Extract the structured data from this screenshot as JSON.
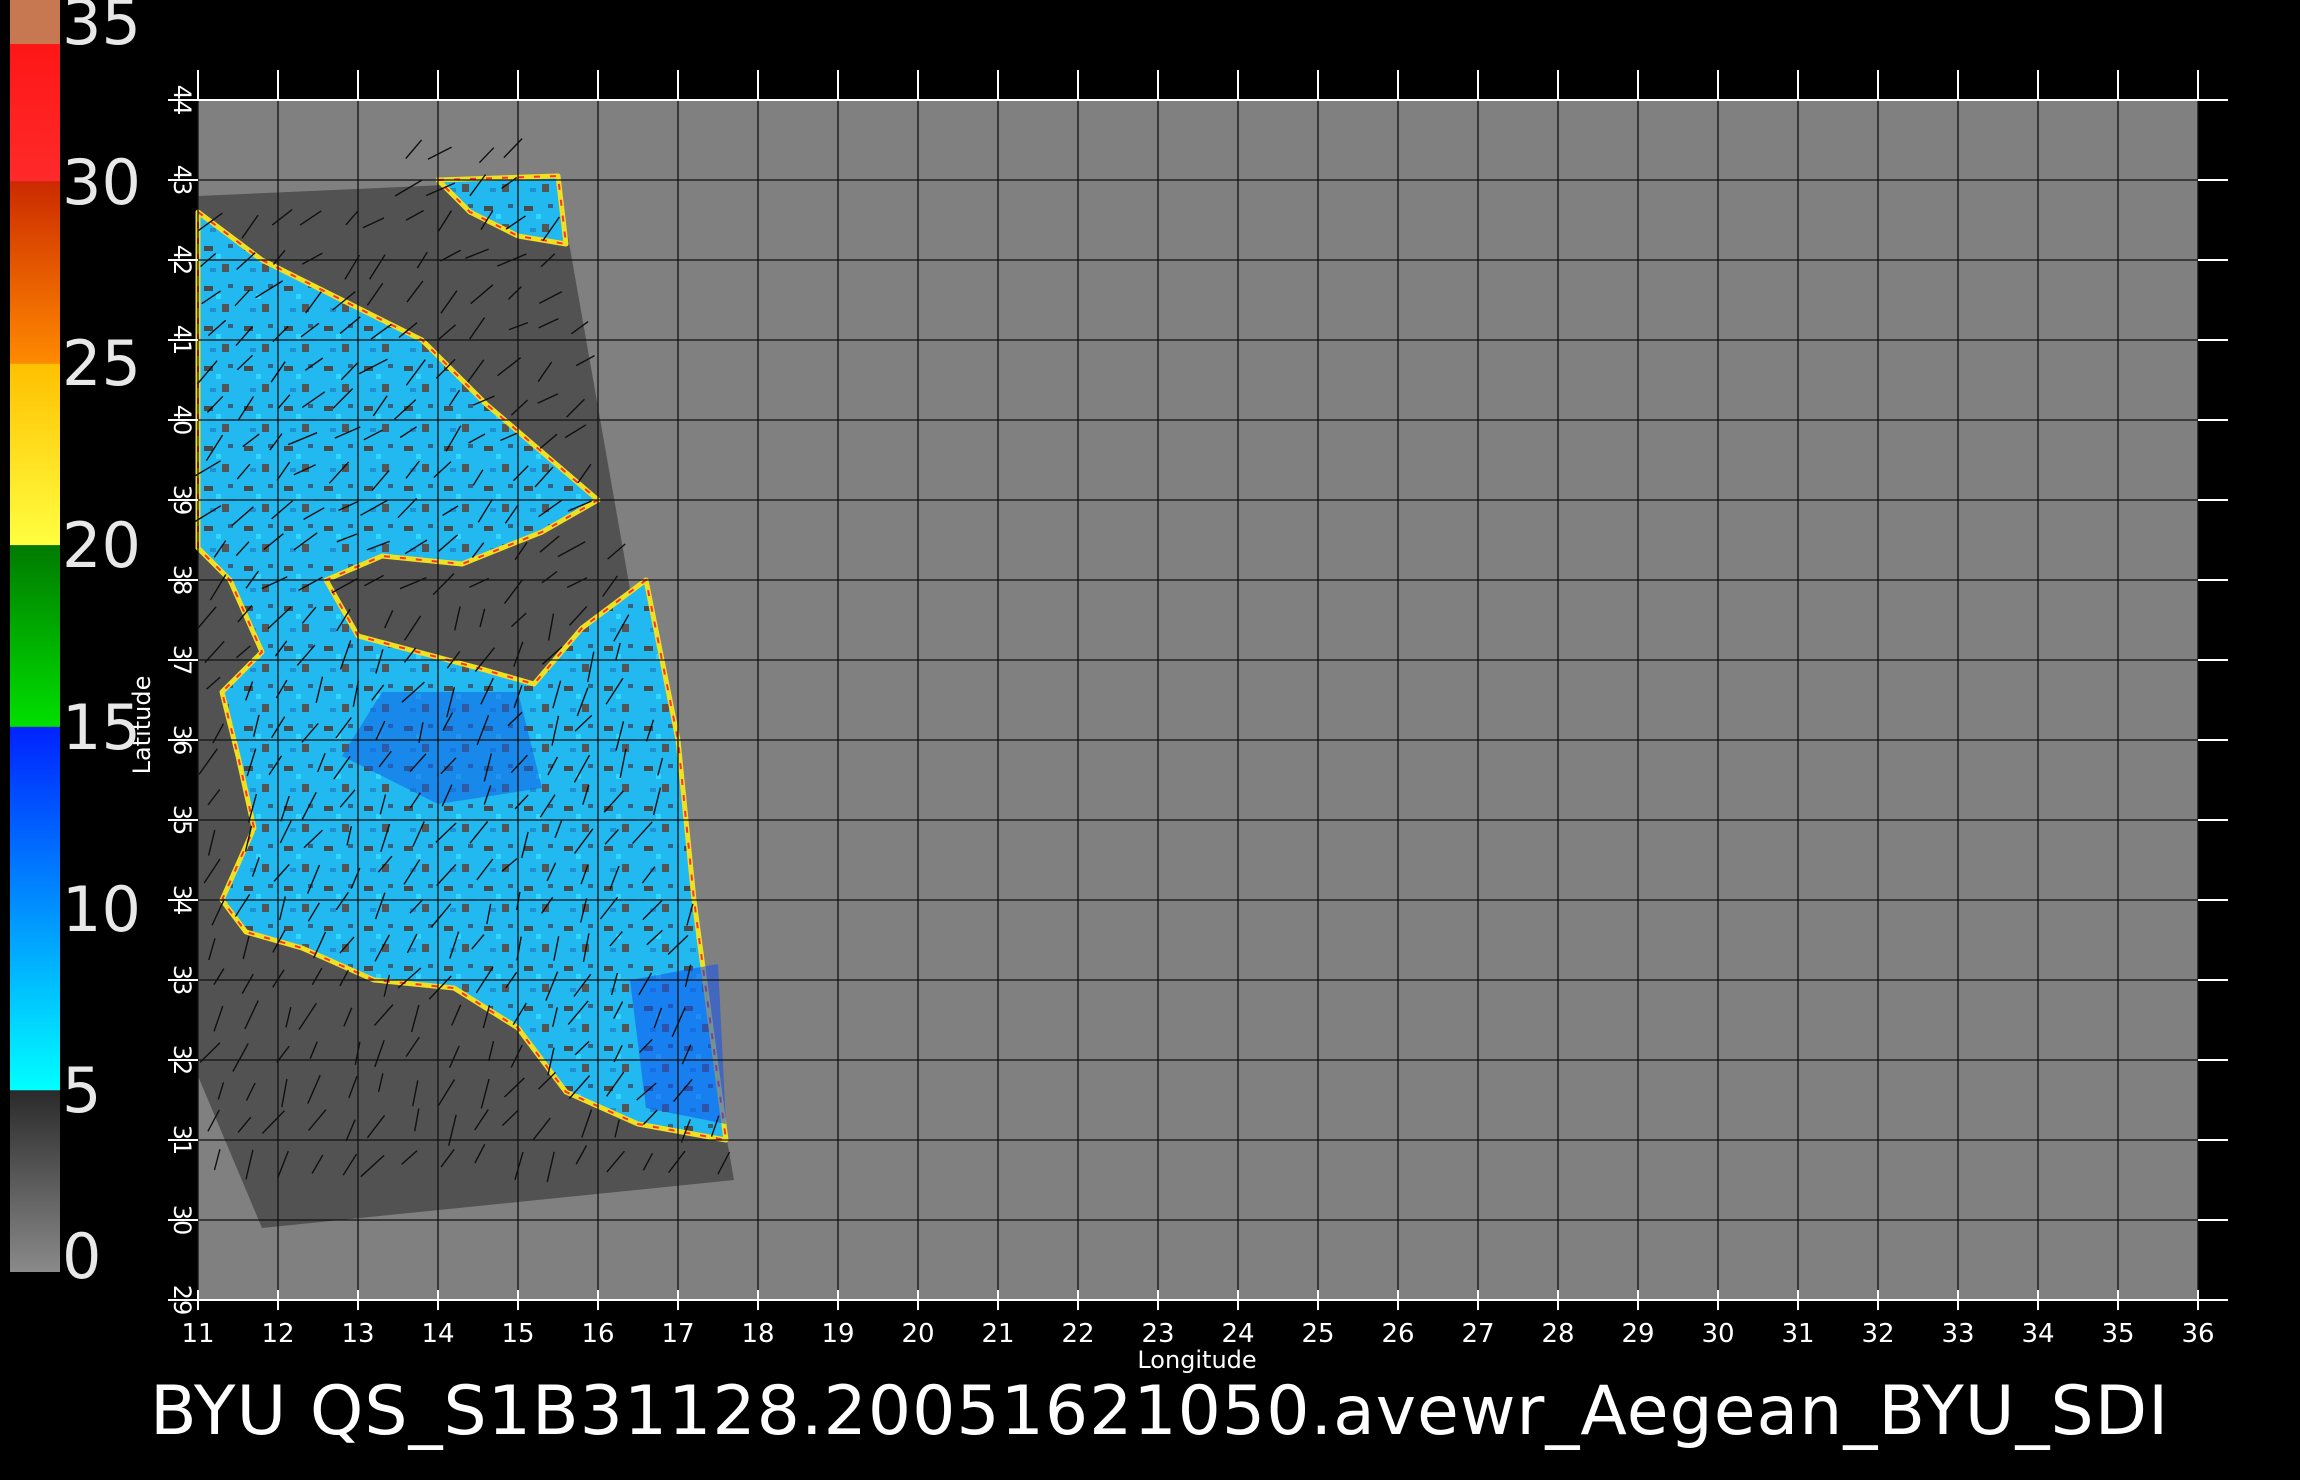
{
  "footer": {
    "caption": "BYU QS_S1B31128.20051621050.avewr_Aegean_BYU_SDI"
  },
  "colorbar": {
    "labels": [
      "35",
      "30",
      "25",
      "20",
      "15",
      "10",
      "5",
      "0"
    ],
    "values": [
      35,
      30,
      25,
      20,
      15,
      10,
      5,
      0
    ],
    "segments": [
      {
        "from": 0,
        "to": 5,
        "color_top": "#2a2a2a",
        "color_bottom": "#8a8a8a"
      },
      {
        "from": 5,
        "to": 15,
        "color_top": "#0022ff",
        "color_bottom": "#00ffff"
      },
      {
        "from": 15,
        "to": 20,
        "color_top": "#007a00",
        "color_bottom": "#00e000"
      },
      {
        "from": 20,
        "to": 25,
        "color_top": "#ffc000",
        "color_bottom": "#ffff40"
      },
      {
        "from": 25,
        "to": 30,
        "color_top": "#cc2a00",
        "color_bottom": "#ff8a00"
      },
      {
        "from": 30,
        "to": 35,
        "color_top": "#ff1010",
        "color_bottom": "#ff2a2a"
      }
    ]
  },
  "map": {
    "xlabel": "Longitude",
    "ylabel": "Latitude",
    "xlim": [
      11,
      36
    ],
    "ylim": [
      29,
      44
    ],
    "xticks": [
      "11",
      "12",
      "13",
      "14",
      "15",
      "16",
      "17",
      "18",
      "19",
      "20",
      "21",
      "22",
      "23",
      "24",
      "25",
      "26",
      "27",
      "28",
      "29",
      "30",
      "31",
      "32",
      "33",
      "34",
      "35",
      "36"
    ],
    "yticks": [
      "29",
      "30",
      "31",
      "32",
      "33",
      "34",
      "35",
      "36",
      "37",
      "38",
      "39",
      "40",
      "41",
      "42",
      "43",
      "44"
    ],
    "background_color": "#808080",
    "land_color": "#525252",
    "swath_lonlat": [
      [
        11.0,
        42.8
      ],
      [
        15.5,
        43.0
      ],
      [
        17.7,
        30.5
      ],
      [
        11.8,
        29.9
      ],
      [
        11.0,
        31.8
      ]
    ],
    "sea_regions": [
      [
        [
          11.0,
          42.6
        ],
        [
          11.8,
          42.0
        ],
        [
          12.8,
          41.5
        ],
        [
          13.8,
          41.0
        ],
        [
          14.6,
          40.2
        ],
        [
          15.3,
          39.6
        ],
        [
          16.0,
          39.0
        ],
        [
          15.3,
          38.6
        ],
        [
          14.3,
          38.2
        ],
        [
          13.3,
          38.3
        ],
        [
          12.6,
          38.0
        ],
        [
          13.0,
          37.3
        ],
        [
          14.5,
          36.9
        ],
        [
          15.2,
          36.7
        ],
        [
          15.8,
          37.4
        ],
        [
          16.6,
          38.0
        ],
        [
          17.0,
          36.0
        ],
        [
          17.2,
          34.0
        ],
        [
          17.6,
          31.0
        ],
        [
          16.5,
          31.2
        ],
        [
          15.6,
          31.6
        ],
        [
          15.0,
          32.4
        ],
        [
          14.2,
          32.9
        ],
        [
          13.2,
          33.0
        ],
        [
          12.3,
          33.4
        ],
        [
          11.6,
          33.6
        ],
        [
          11.3,
          34.0
        ],
        [
          11.7,
          34.9
        ],
        [
          11.5,
          35.8
        ],
        [
          11.3,
          36.6
        ],
        [
          11.8,
          37.1
        ],
        [
          11.4,
          38.0
        ],
        [
          11.0,
          38.4
        ]
      ],
      [
        [
          14.0,
          43.0
        ],
        [
          15.5,
          43.05
        ],
        [
          15.6,
          42.2
        ],
        [
          15.0,
          42.3
        ],
        [
          14.4,
          42.6
        ]
      ]
    ],
    "coast_color": "#f0e020",
    "wind_arrow_color": "#101010",
    "grid_color": "#111111"
  }
}
